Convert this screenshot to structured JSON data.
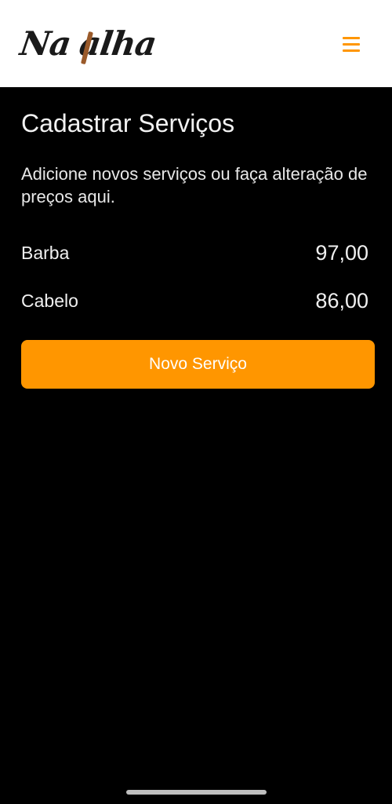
{
  "header": {
    "logo_text": "NaValha",
    "logo_text_left": "Na",
    "logo_text_right": "alha",
    "menu_icon": "hamburger-menu-icon"
  },
  "page": {
    "title": "Cadastrar Serviços",
    "subtitle": "Adicione novos serviços ou faça alteração de preços aqui."
  },
  "services": [
    {
      "name": "Barba",
      "price": "97,00"
    },
    {
      "name": "Cabelo",
      "price": "86,00"
    }
  ],
  "actions": {
    "new_service_label": "Novo Serviço"
  },
  "colors": {
    "accent": "#ff9600",
    "background": "#000000",
    "header_background": "#ffffff",
    "logo_accent": "#9a5a2a"
  }
}
